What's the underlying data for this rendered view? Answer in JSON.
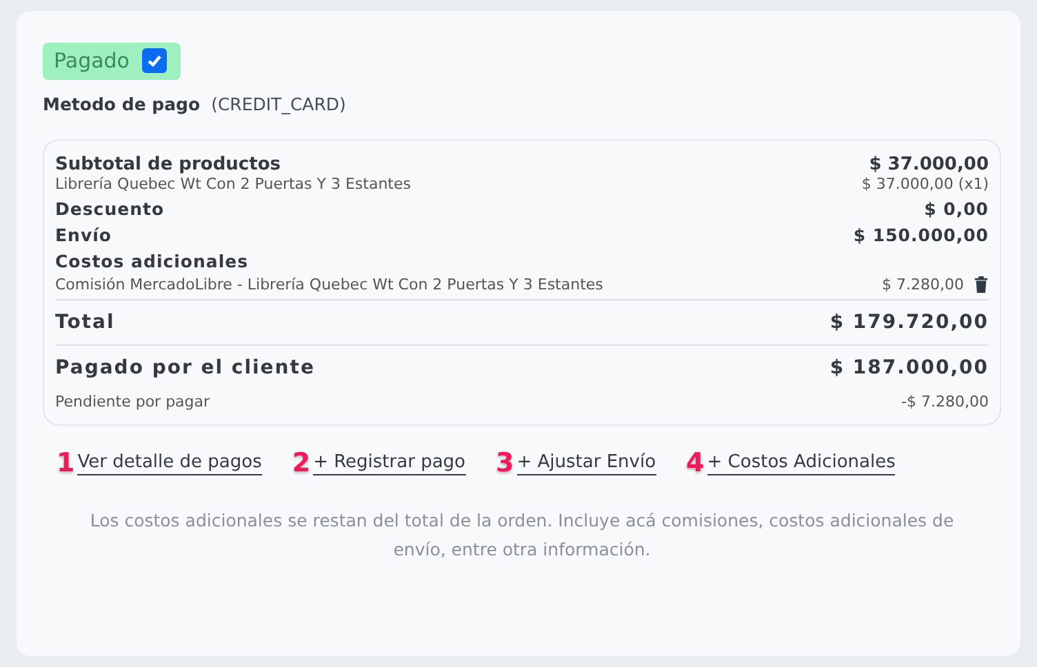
{
  "paid": {
    "label": "Pagado",
    "checked": true
  },
  "payment_method": {
    "label": "Metodo de pago",
    "value": "(CREDIT_CARD)"
  },
  "summary": [
    {
      "kind": "heading",
      "label": "Subtotal de productos",
      "amount": "$ 37.000,00"
    },
    {
      "kind": "detail",
      "label": "Librería Quebec Wt Con 2 Puertas Y 3 Estantes",
      "amount": "$ 37.000,00 (x1)"
    },
    {
      "kind": "line",
      "label": "Descuento",
      "amount": "$ 0,00"
    },
    {
      "kind": "line",
      "label": "Envío",
      "amount": "$ 150.000,00"
    },
    {
      "kind": "section",
      "label": "Costos adicionales"
    },
    {
      "kind": "cost",
      "label": "Comisión MercadoLibre - Librería Quebec Wt Con 2 Puertas Y 3 Estantes",
      "amount": "$ 7.280,00"
    },
    {
      "kind": "total",
      "label": "Total",
      "amount": "$ 179.720,00"
    },
    {
      "kind": "total",
      "label": "Pagado por el cliente",
      "amount": "$ 187.000,00"
    },
    {
      "kind": "pending",
      "label": "Pendiente por pagar",
      "amount": "-$ 7.280,00"
    }
  ],
  "links": [
    {
      "marker": "1",
      "label": "Ver detalle de pagos"
    },
    {
      "marker": "2",
      "label": "+ Registrar pago"
    },
    {
      "marker": "3",
      "label": "+ Ajustar Envío"
    },
    {
      "marker": "4",
      "label": "+ Costos Adicionales"
    }
  ],
  "note": "Los costos adicionales se restan del total de la orden. Incluye acá comisiones, costos adicionales de envío, entre otra información."
}
